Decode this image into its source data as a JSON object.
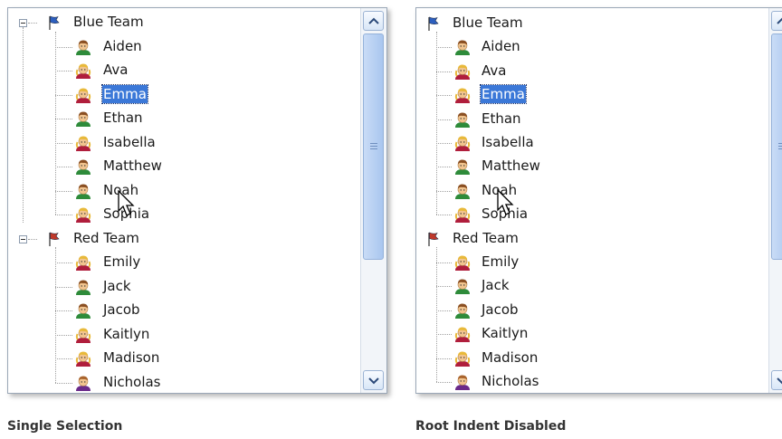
{
  "left": {
    "caption": "Single Selection",
    "groups": [
      {
        "name": "Blue Team",
        "flag_color": "#2d5fbf",
        "members": [
          {
            "name": "Aiden",
            "gender": "boy"
          },
          {
            "name": "Ava",
            "gender": "girl"
          },
          {
            "name": "Emma",
            "gender": "girl",
            "selected": true
          },
          {
            "name": "Ethan",
            "gender": "boy"
          },
          {
            "name": "Isabella",
            "gender": "girl"
          },
          {
            "name": "Matthew",
            "gender": "boy"
          },
          {
            "name": "Noah",
            "gender": "boy"
          },
          {
            "name": "Sophia",
            "gender": "girl"
          }
        ]
      },
      {
        "name": "Red Team",
        "flag_color": "#c0392b",
        "members": [
          {
            "name": "Emily",
            "gender": "girl"
          },
          {
            "name": "Jack",
            "gender": "boy"
          },
          {
            "name": "Jacob",
            "gender": "boy"
          },
          {
            "name": "Kaitlyn",
            "gender": "girl"
          },
          {
            "name": "Madison",
            "gender": "girl"
          },
          {
            "name": "Nicholas",
            "gender": "boy2"
          }
        ]
      }
    ]
  },
  "right": {
    "caption": "Root Indent Disabled",
    "groups": [
      {
        "name": "Blue Team",
        "flag_color": "#2d5fbf",
        "members": [
          {
            "name": "Aiden",
            "gender": "boy"
          },
          {
            "name": "Ava",
            "gender": "girl"
          },
          {
            "name": "Emma",
            "gender": "girl",
            "selected": true
          },
          {
            "name": "Ethan",
            "gender": "boy"
          },
          {
            "name": "Isabella",
            "gender": "girl"
          },
          {
            "name": "Matthew",
            "gender": "boy"
          },
          {
            "name": "Noah",
            "gender": "boy"
          },
          {
            "name": "Sophia",
            "gender": "girl"
          }
        ]
      },
      {
        "name": "Red Team",
        "flag_color": "#c0392b",
        "members": [
          {
            "name": "Emily",
            "gender": "girl"
          },
          {
            "name": "Jack",
            "gender": "boy"
          },
          {
            "name": "Jacob",
            "gender": "boy"
          },
          {
            "name": "Kaitlyn",
            "gender": "girl"
          },
          {
            "name": "Madison",
            "gender": "girl"
          },
          {
            "name": "Nicholas",
            "gender": "boy2"
          }
        ]
      }
    ]
  },
  "colors": {
    "selection": "#3b78d8",
    "border": "#9aa7b7",
    "scroll_thumb": "#a9c6ef"
  },
  "icons": [
    "flag-icon",
    "person-icon",
    "collapse-toggle-icon",
    "scroll-up-arrow-icon",
    "scroll-down-arrow-icon",
    "mouse-pointer-icon"
  ]
}
